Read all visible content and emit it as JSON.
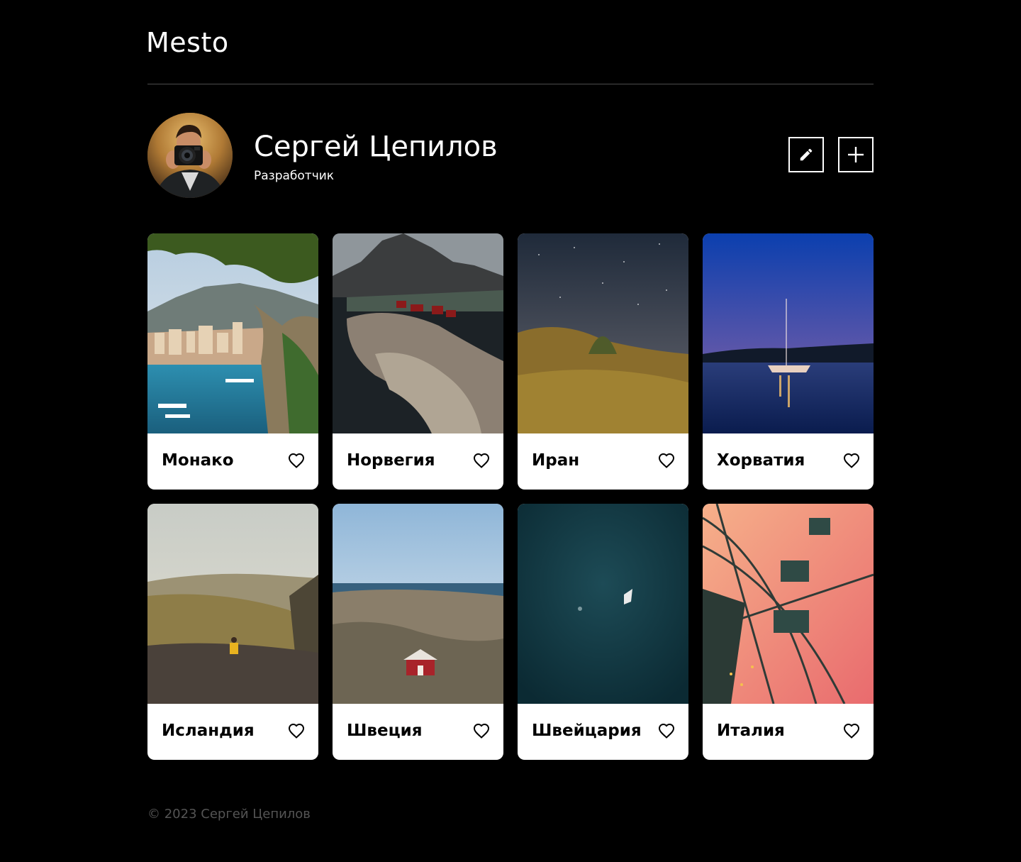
{
  "header": {
    "logo": "Mesto"
  },
  "profile": {
    "name": "Сергей Цепилов",
    "about": "Разработчик",
    "edit_icon": "pencil-icon",
    "add_icon": "plus-icon"
  },
  "cards": [
    {
      "title": "Монако",
      "like_icon": "heart-icon"
    },
    {
      "title": "Норвегия",
      "like_icon": "heart-icon"
    },
    {
      "title": "Иран",
      "like_icon": "heart-icon"
    },
    {
      "title": "Хорватия",
      "like_icon": "heart-icon"
    },
    {
      "title": "Исландия",
      "like_icon": "heart-icon"
    },
    {
      "title": "Швеция",
      "like_icon": "heart-icon"
    },
    {
      "title": "Швейцария",
      "like_icon": "heart-icon"
    },
    {
      "title": "Италия",
      "like_icon": "heart-icon"
    }
  ],
  "footer": {
    "copyright": "© 2023 Сергей Цепилов"
  },
  "colors": {
    "background": "#000000",
    "text": "#ffffff",
    "card": "#ffffff",
    "footer_text": "#545454"
  }
}
